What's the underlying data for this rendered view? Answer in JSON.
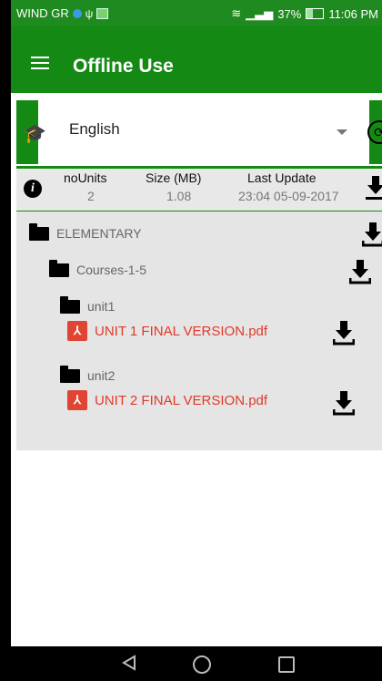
{
  "status_bar": {
    "carrier": "WIND GR",
    "battery": "37%",
    "time": "11:06 PM"
  },
  "app_bar": {
    "title": "Offline Use"
  },
  "language": {
    "selected": "English"
  },
  "info": {
    "headers": [
      "noUnits",
      "Size (MB)",
      "Last Update"
    ],
    "values": [
      "2",
      "1.08",
      "23:04 05-09-2017"
    ]
  },
  "tree": {
    "level1": "ELEMENTARY",
    "level2": "Courses-1-5",
    "units": [
      {
        "name": "unit1",
        "file": "UNIT 1 FINAL VERSION.pdf"
      },
      {
        "name": "unit2",
        "file": "UNIT 2 FINAL VERSION.pdf"
      }
    ]
  },
  "colors": {
    "accent": "#148a14",
    "pdf": "#e03a2a"
  }
}
